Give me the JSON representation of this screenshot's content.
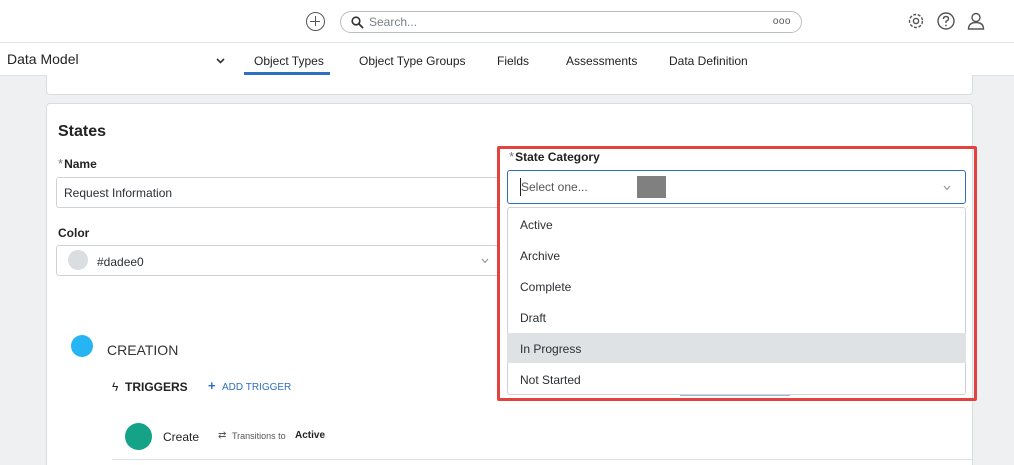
{
  "topbar": {
    "search_placeholder": "Search...",
    "search_more": "ooo"
  },
  "subnav": {
    "title": "Data Model",
    "tabs": [
      {
        "label": "Object Types",
        "active": true
      },
      {
        "label": "Object Type Groups",
        "active": false
      },
      {
        "label": "Fields",
        "active": false
      },
      {
        "label": "Assessments",
        "active": false
      },
      {
        "label": "Data Definition",
        "active": false
      }
    ]
  },
  "form": {
    "section_title": "States",
    "required_mark": "*",
    "name_label": "Name",
    "name_value": "Request Information",
    "color_label": "Color",
    "color_value": "#dadee0"
  },
  "state_category": {
    "label": "State Category",
    "placeholder": "Select one...",
    "options": [
      "Active",
      "Archive",
      "Complete",
      "Draft",
      "In Progress",
      "Not Started"
    ],
    "hovered_option": "In Progress"
  },
  "workflow": {
    "state_name": "CREATION",
    "triggers_label": "TRIGGERS",
    "add_trigger_label": "ADD TRIGGER",
    "trigger": {
      "name": "Create",
      "transition_text": "Transitions to",
      "target": "Active"
    }
  },
  "colors": {
    "accent": "#2d6fc0",
    "highlight_border": "#e4423f",
    "creation_dot": "#26b4f2",
    "create_dot": "#14a386",
    "swatch": "#dadee0"
  }
}
